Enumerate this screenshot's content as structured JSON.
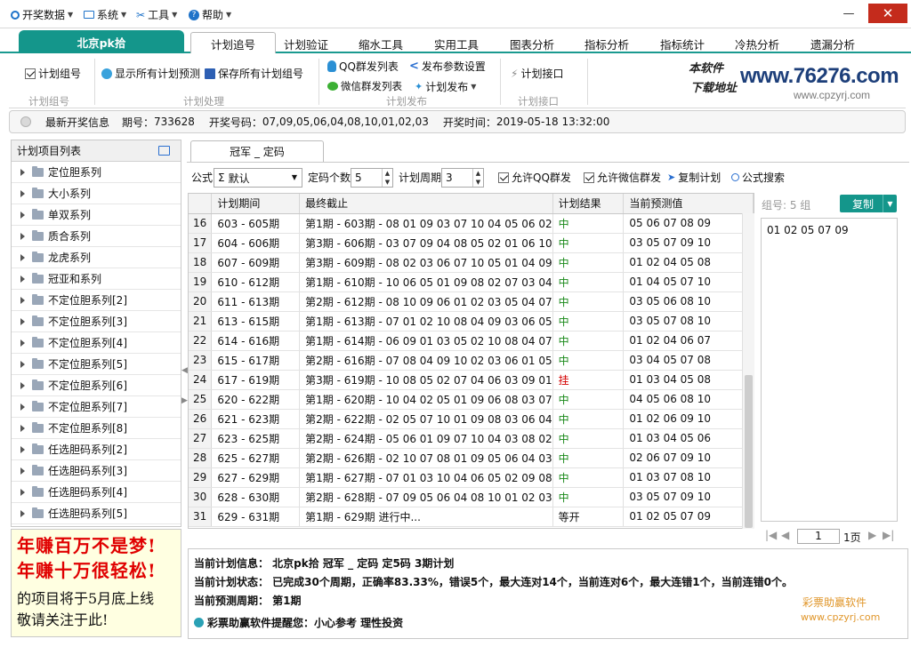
{
  "menu": {
    "items": [
      {
        "label": "开奖数据",
        "icon": "ring-icon"
      },
      {
        "label": "系统",
        "icon": "monitor-icon"
      },
      {
        "label": "工具",
        "icon": "tools-icon"
      },
      {
        "label": "帮助",
        "icon": "help-icon"
      }
    ]
  },
  "window": {
    "minimize": "—",
    "close": "✕"
  },
  "tabs": {
    "app": "北京pk拾",
    "items": [
      "计划追号",
      "计划验证",
      "缩水工具",
      "实用工具",
      "图表分析",
      "指标分析",
      "指标统计",
      "冷热分析",
      "遗漏分析"
    ],
    "active_index": 0
  },
  "ribbon": {
    "plan_group_checkbox": "计划组号",
    "plan_group_label": "计划组号",
    "show_all_predictions": "显示所有计划预测",
    "save_all_plans": "保存所有计划组号",
    "plan_process_label": "计划处理",
    "qq_group_list": "QQ群发列表",
    "wechat_group_list": "微信群发列表",
    "publish_params": "发布参数设置",
    "plan_publish": "计划发布",
    "publish_label": "计划发布",
    "plan_interface": "计划接口",
    "interface_label": "计划接口"
  },
  "logo": {
    "line1": "本软件",
    "line2": "下载地址",
    "domain_main": "www.76276.com",
    "domain_sub": "www.cpzyrj.com"
  },
  "infobar": {
    "latest": "最新开奖信息",
    "period_label": "期号：",
    "period": "733628",
    "numbers_label": "开奖号码：",
    "numbers": "07,09,05,06,04,08,10,01,02,03",
    "time_label": "开奖时间：",
    "time": "2019-05-18 13:32:00"
  },
  "left": {
    "header": "计划项目列表",
    "items": [
      "定位胆系列",
      "大小系列",
      "单双系列",
      "质合系列",
      "龙虎系列",
      "冠亚和系列",
      "不定位胆系列[2]",
      "不定位胆系列[3]",
      "不定位胆系列[4]",
      "不定位胆系列[5]",
      "不定位胆系列[6]",
      "不定位胆系列[7]",
      "不定位胆系列[8]",
      "任选胆码系列[2]",
      "任选胆码系列[3]",
      "任选胆码系列[4]",
      "任选胆码系列[5]"
    ]
  },
  "ad": {
    "line1": "年赚百万不是梦!",
    "line2": "年赚十万很轻松!",
    "line3": "的项目将于5月底上线",
    "line4": "敬请关注于此!"
  },
  "content_tab": "冠军 _ 定码",
  "toolbar": {
    "formula_label": "公式",
    "formula_value": "默认",
    "count_label": "定码个数",
    "count_value": "5",
    "cycle_label": "计划周期",
    "cycle_value": "3",
    "allow_qq": "允许QQ群发",
    "allow_wechat": "允许微信群发",
    "copy_plan": "复制计划",
    "formula_search": "公式搜索"
  },
  "grid": {
    "columns": [
      "",
      "计划期间",
      "最终截止",
      "计划结果",
      "当前预测值"
    ],
    "rows": [
      {
        "n": "16",
        "period": "603 - 605期",
        "final": "第1期 - 603期 - 08 01 09 03 07 10 04 05 06 02",
        "result": "中",
        "pred": "05 06 07 08 09"
      },
      {
        "n": "17",
        "period": "604 - 606期",
        "final": "第3期 - 606期 - 03 07 09 04 08 05 02 01 06 10",
        "result": "中",
        "pred": "03 05 07 09 10"
      },
      {
        "n": "18",
        "period": "607 - 609期",
        "final": "第3期 - 609期 - 08 02 03 06 07 10 05 01 04 09",
        "result": "中",
        "pred": "01 02 04 05 08"
      },
      {
        "n": "19",
        "period": "610 - 612期",
        "final": "第1期 - 610期 - 10 06 05 01 09 08 02 07 03 04",
        "result": "中",
        "pred": "01 04 05 07 10"
      },
      {
        "n": "20",
        "period": "611 - 613期",
        "final": "第2期 - 612期 - 08 10 09 06 01 02 03 05 04 07",
        "result": "中",
        "pred": "03 05 06 08 10"
      },
      {
        "n": "21",
        "period": "613 - 615期",
        "final": "第1期 - 613期 - 07 01 02 10 08 04 09 03 06 05",
        "result": "中",
        "pred": "03 05 07 08 10"
      },
      {
        "n": "22",
        "period": "614 - 616期",
        "final": "第1期 - 614期 - 06 09 01 03 05 02 10 08 04 07",
        "result": "中",
        "pred": "01 02 04 06 07"
      },
      {
        "n": "23",
        "period": "615 - 617期",
        "final": "第2期 - 616期 - 07 08 04 09 10 02 03 06 01 05",
        "result": "中",
        "pred": "03 04 05 07 08"
      },
      {
        "n": "24",
        "period": "617 - 619期",
        "final": "第3期 - 619期 - 10 08 05 02 07 04 06 03 09 01",
        "result": "挂",
        "pred": "01 03 04 05 08"
      },
      {
        "n": "25",
        "period": "620 - 622期",
        "final": "第1期 - 620期 - 10 04 02 05 01 09 06 08 03 07",
        "result": "中",
        "pred": "04 05 06 08 10"
      },
      {
        "n": "26",
        "period": "621 - 623期",
        "final": "第2期 - 622期 - 02 05 07 10 01 09 08 03 06 04",
        "result": "中",
        "pred": "01 02 06 09 10"
      },
      {
        "n": "27",
        "period": "623 - 625期",
        "final": "第2期 - 624期 - 05 06 01 09 07 10 04 03 08 02",
        "result": "中",
        "pred": "01 03 04 05 06"
      },
      {
        "n": "28",
        "period": "625 - 627期",
        "final": "第2期 - 626期 - 02 10 07 08 01 09 05 06 04 03",
        "result": "中",
        "pred": "02 06 07 09 10"
      },
      {
        "n": "29",
        "period": "627 - 629期",
        "final": "第1期 - 627期 - 07 01 03 10 04 06 05 02 09 08",
        "result": "中",
        "pred": "01 03 07 08 10"
      },
      {
        "n": "30",
        "period": "628 - 630期",
        "final": "第2期 - 628期 - 07 09 05 06 04 08 10 01 02 03",
        "result": "中",
        "pred": "03 05 07 09 10"
      },
      {
        "n": "31",
        "period": "629 - 631期",
        "final": "第1期 - 629期 进行中...",
        "result": "等开",
        "pred": "01 02 05 07 09"
      }
    ]
  },
  "right": {
    "group_label": "组号: 5 组",
    "copy_button": "复制",
    "prediction": "01 02 05 07 09",
    "page_value": "1",
    "page_suffix": "1页"
  },
  "bottom": {
    "line1": "当前计划信息： 北京pk拾    冠军 _ 定码    定5码    3期计划",
    "line2": "当前计划状态： 已完成30个周期，正确率83.33%，错误5个，最大连对14个，当前连对6个，最大连错1个，当前连错0个。",
    "line3": "当前预测周期： 第1期",
    "line4": "彩票助赢软件提醒您：小心参考   理性投资",
    "brand": "彩票助赢软件",
    "brand_url": "www.cpzyrj.com"
  },
  "colors": {
    "accent": "#14968b",
    "win": "#1a8a1a",
    "lose": "#d40000",
    "brand": "#e0962a"
  }
}
